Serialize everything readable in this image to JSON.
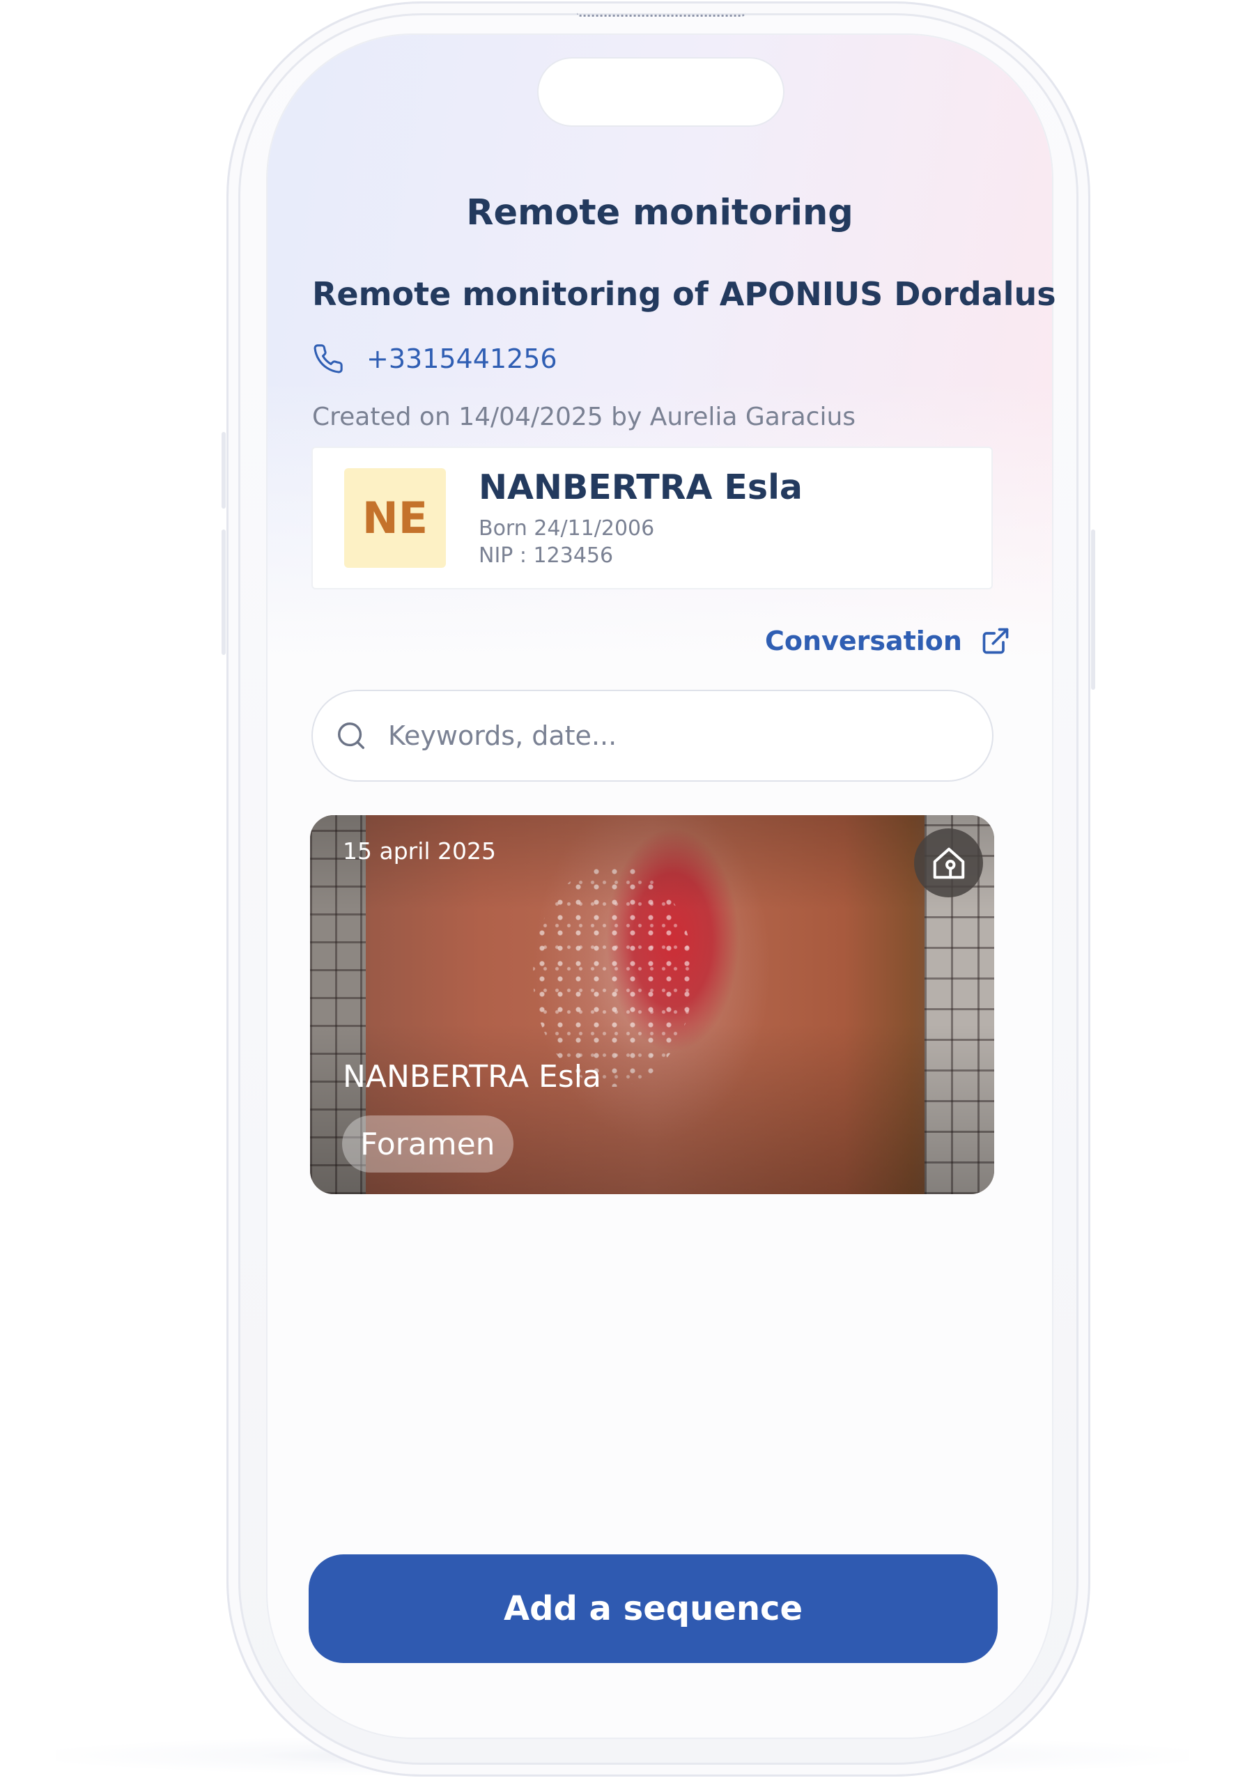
{
  "header": {
    "title": "Remote monitoring"
  },
  "monitoring": {
    "title": "Remote monitoring of APONIUS Dordalus",
    "phone": "+3315441256",
    "created": "Created on 14/04/2025 by Aurelia Garacius"
  },
  "patient": {
    "initials": "NE",
    "name": "NANBERTRA Esla",
    "born": "Born 24/11/2006",
    "nip": "NIP : 123456"
  },
  "conversation": {
    "label": "Conversation",
    "icon": "external-link-icon"
  },
  "search": {
    "placeholder": "Keywords, date...",
    "value": "",
    "icon": "search-icon"
  },
  "media_card": {
    "date": "15 april 2025",
    "patient": "NANBERTRA Esla",
    "tag": "Foramen",
    "badge_icon": "home-icon"
  },
  "actions": {
    "add_label": "Add a sequence"
  },
  "colors": {
    "primary": "#2f5ab1",
    "title": "#233a5e",
    "link": "#2f5eb3",
    "muted": "#7a8193",
    "avatar_bg": "#fdf1c5",
    "avatar_text": "#c4722b"
  }
}
